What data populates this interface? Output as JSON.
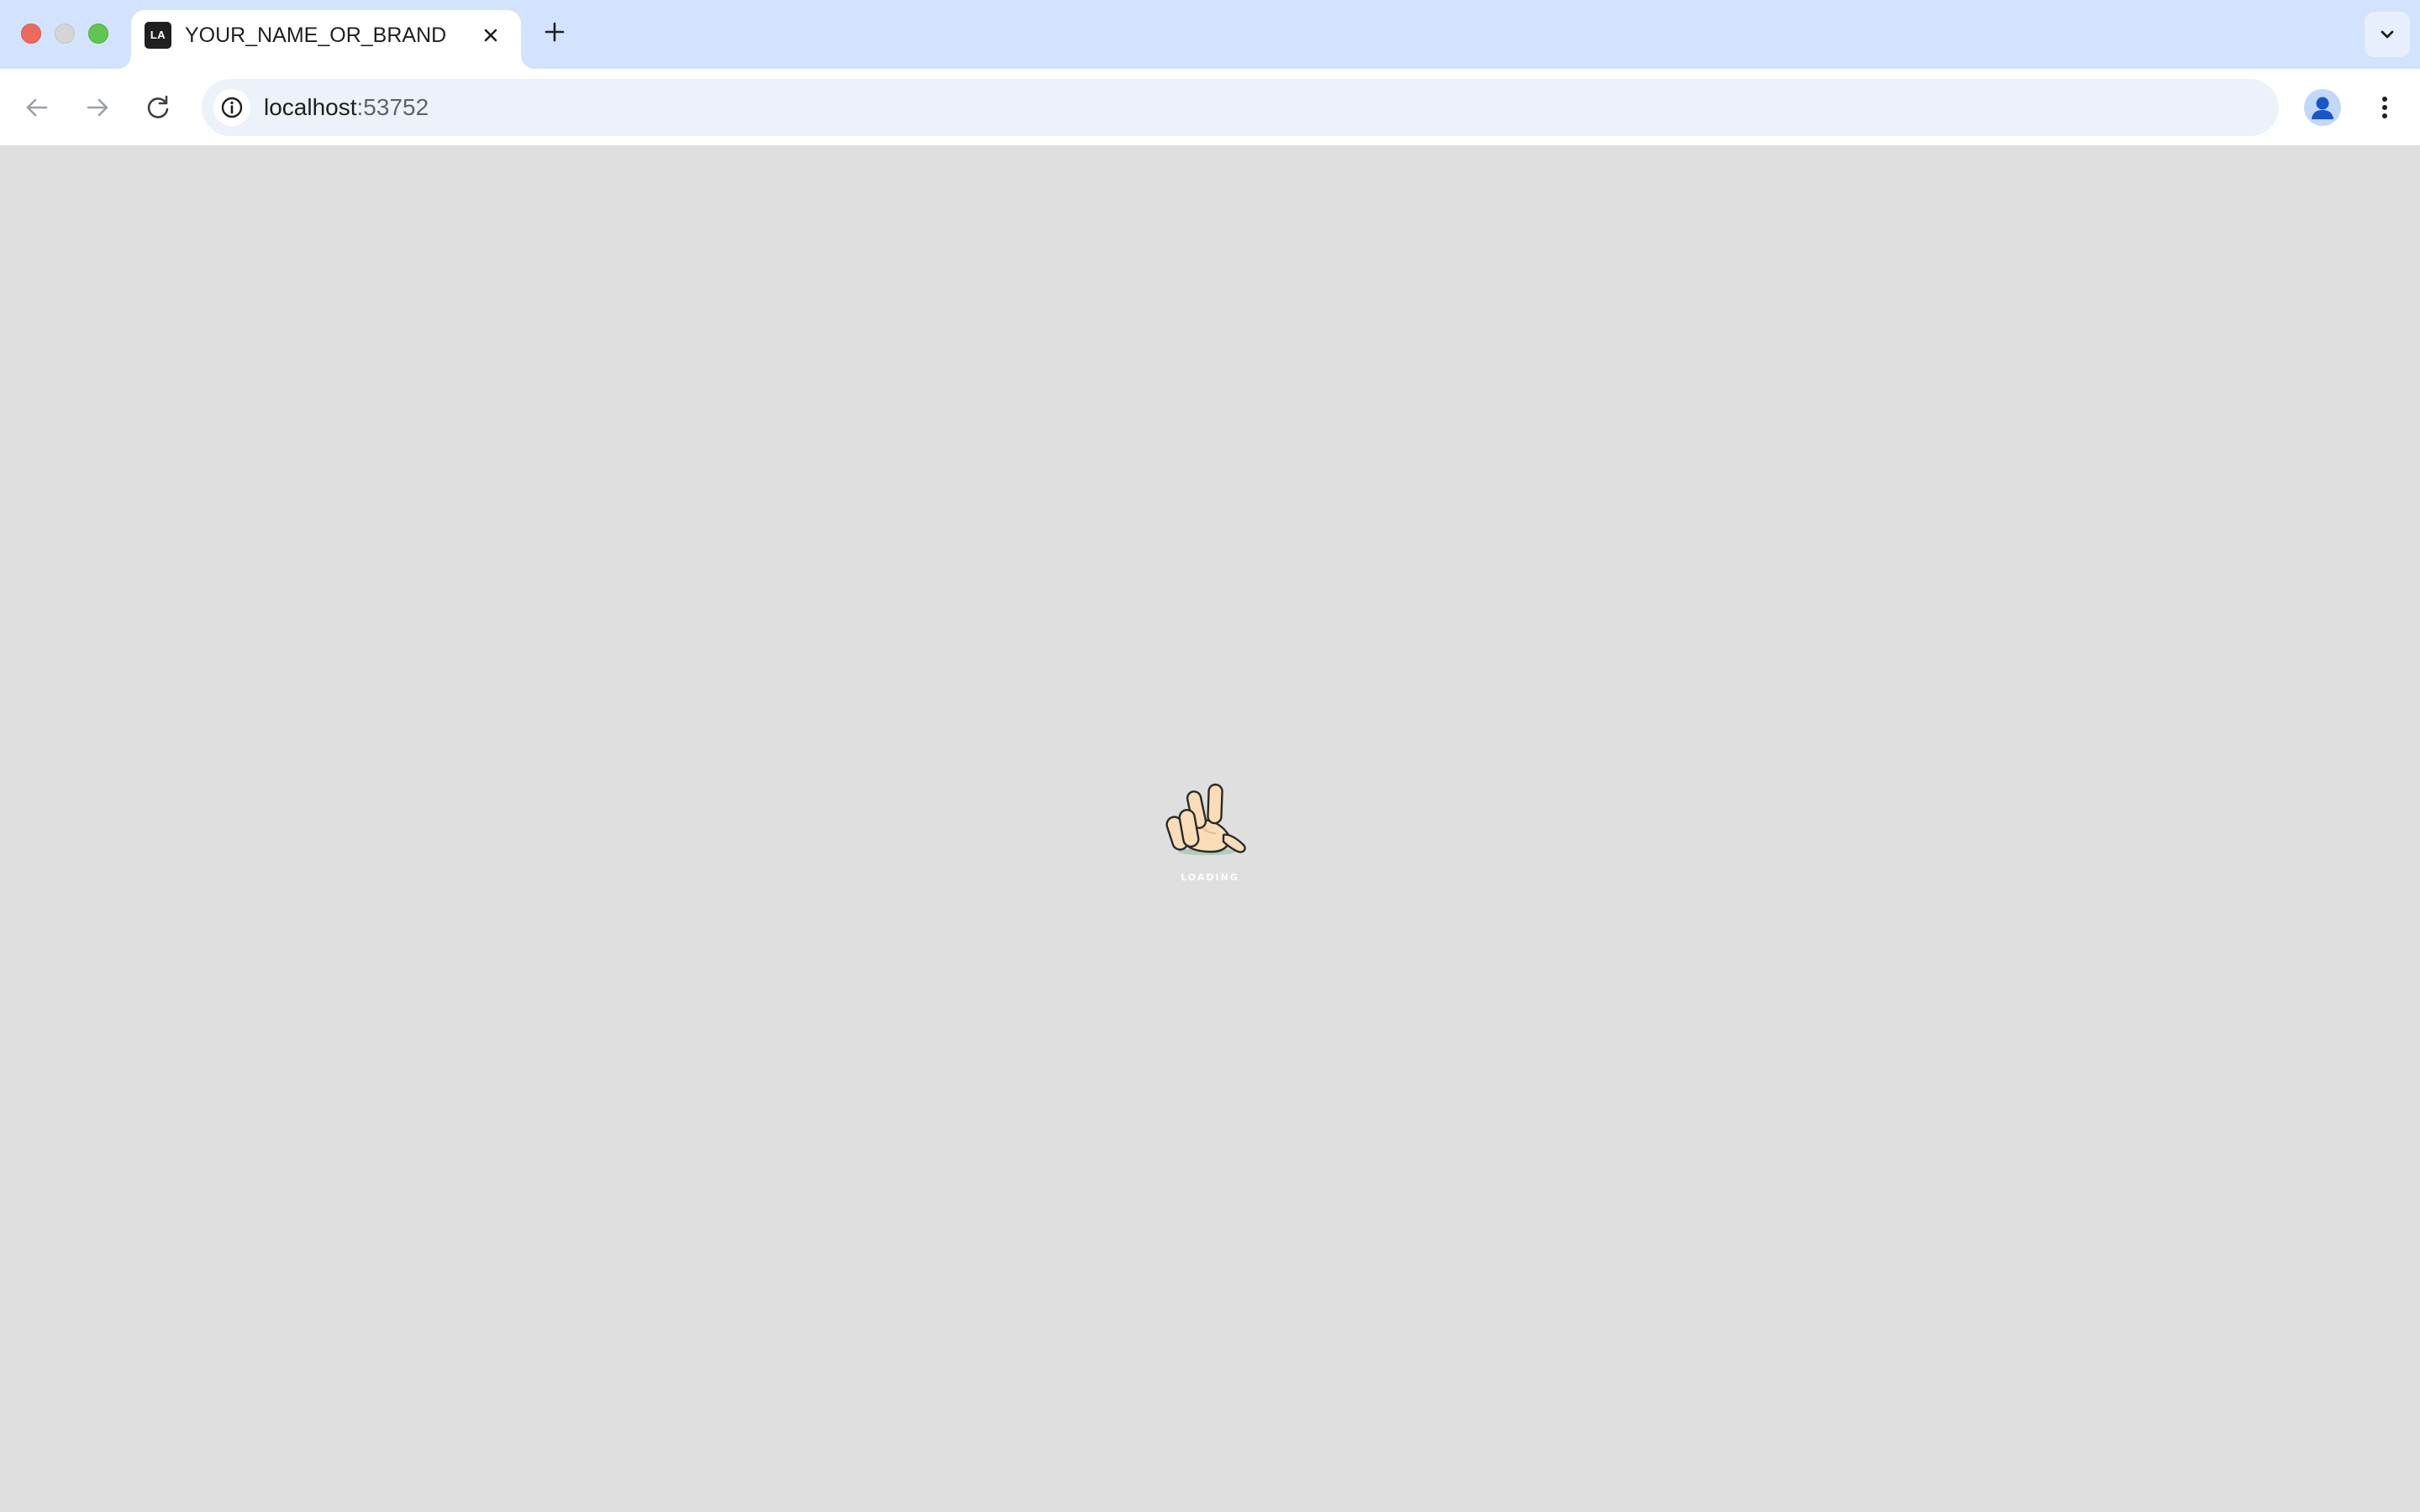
{
  "window": {
    "controls": {
      "close_color": "#ed6a5e",
      "minimize_color": "#d5d5d5",
      "maximize_color": "#61c554"
    }
  },
  "tabs": [
    {
      "favicon_text": "LA",
      "title": "YOUR_NAME_OR_BRAND",
      "active": true
    }
  ],
  "toolbar": {
    "back_icon": "arrow-left-icon",
    "forward_icon": "arrow-right-icon",
    "reload_icon": "reload-icon",
    "site_info_icon": "info-icon",
    "url_host": "localhost",
    "url_port": ":53752",
    "bookmark_icon": "star-icon",
    "profile_icon": "avatar-icon",
    "menu_icon": "kebab-menu-icon"
  },
  "page": {
    "background": "#dfdfdf",
    "loader_icon": "hand-icon",
    "loading_text": "LOADING"
  }
}
